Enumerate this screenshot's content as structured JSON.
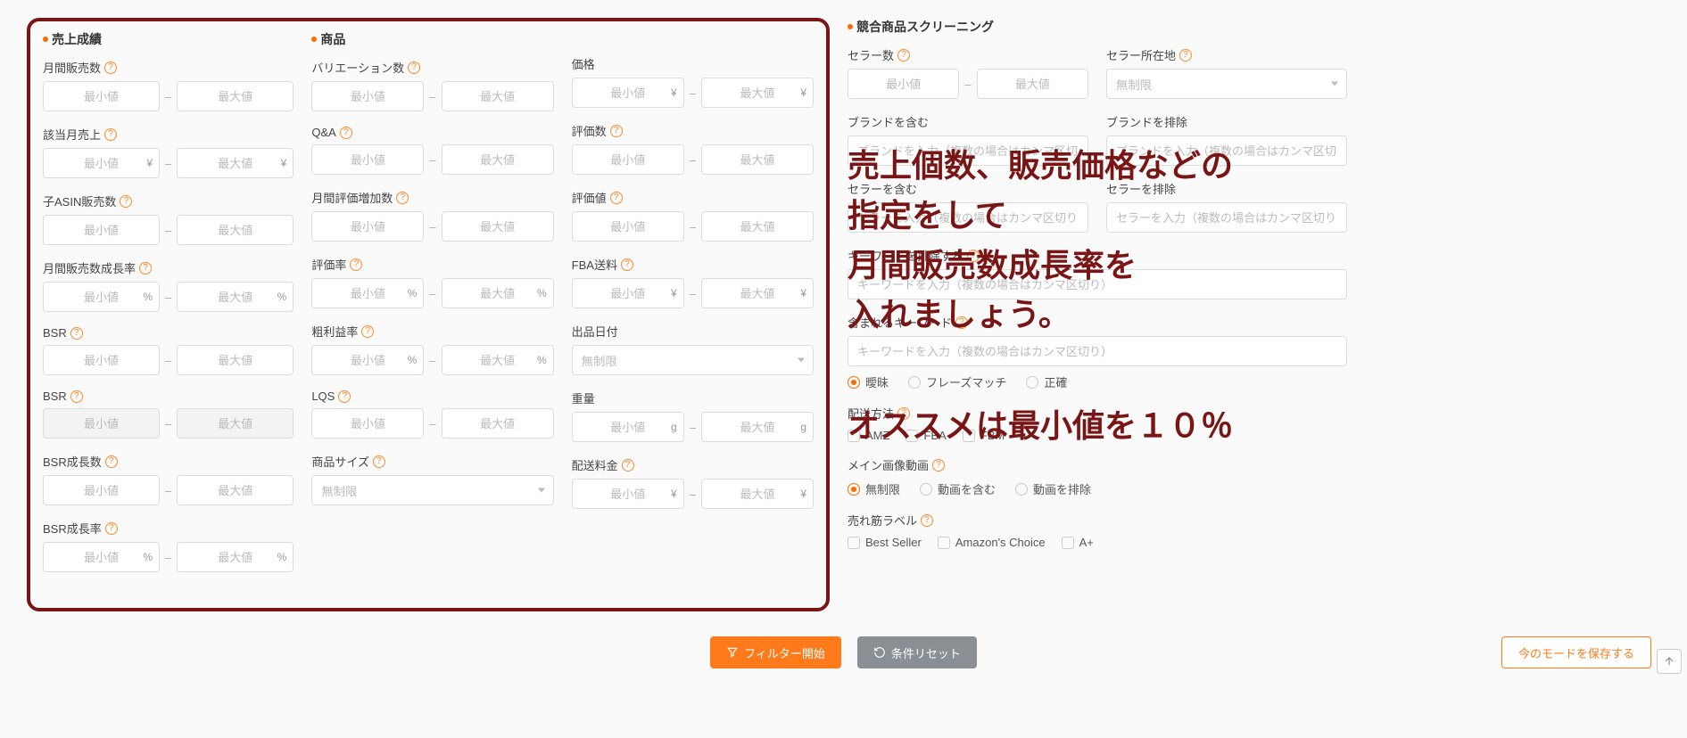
{
  "ph": {
    "min": "最小値",
    "max": "最大値",
    "unlimited": "無制限"
  },
  "units": {
    "yen": "¥",
    "pct": "%",
    "g": "g"
  },
  "sales": {
    "title": "売上成績",
    "fields": {
      "monthlySales": "月間販売数",
      "monthlyRevenue": "該当月売上",
      "childAsinSales": "子ASIN販売数",
      "monthlySalesGrowth": "月間販売数成長率",
      "bsr1": "BSR",
      "bsr2": "BSR",
      "bsrGrowthCount": "BSR成長数",
      "bsrGrowthRate": "BSR成長率"
    }
  },
  "product": {
    "title": "商品",
    "fields": {
      "variations": "バリエーション数",
      "qa": "Q&A",
      "monthlyReviewInc": "月間評価増加数",
      "reviewRate": "評価率",
      "grossMargin": "粗利益率",
      "lqs": "LQS",
      "size": "商品サイズ",
      "price": "価格",
      "reviewCount": "評価数",
      "reviewValue": "評価値",
      "fbaFee": "FBA送料",
      "listDate": "出品日付",
      "weight": "重量",
      "shipFee": "配送料金"
    }
  },
  "comp": {
    "title": "競合商品スクリーニング",
    "fields": {
      "sellerCount": "セラー数",
      "sellerLocation": "セラー所在地",
      "brandInclude": "ブランドを含む",
      "brandExclude": "ブランドを排除",
      "sellerIncludeLabel": "セラーを含む",
      "sellerExcludeLabel": "セラーを排除",
      "brandPh": "ブランドを入力（複数の場合はカンマ区切り）",
      "sellerPh": "セラーを入力（複数の場合はカンマ区切り）",
      "kwExclude": "キーワードを排除する",
      "kwInclude": "含まれるキーワード",
      "kwPh": "キーワードを入力（複数の場合はカンマ区切り）",
      "matchLabel": "",
      "match": {
        "fuzzy": "曖昧",
        "phrase": "フレーズマッチ",
        "exact": "正確"
      },
      "shipMethod": "配送方法",
      "ship": {
        "amz": "AMZ",
        "fba": "FBA",
        "fbm": "FBM"
      },
      "mainVideo": "メイン画像動画",
      "video": {
        "unl": "無制限",
        "inc": "動画を含む",
        "exc": "動画を排除"
      },
      "bestsellerLabel": "売れ筋ラベル",
      "bs": {
        "bestSeller": "Best Seller",
        "ac": "Amazon's Choice",
        "aplus": "A+"
      }
    }
  },
  "buttons": {
    "filter": "フィルター開始",
    "reset": "条件リセット",
    "save": "今のモードを保存する"
  },
  "overlay": {
    "block1": "売上個数、販売価格などの\n指定をして\n月間販売数成長率を\n入れましょう。",
    "block2": "オススメは最小値を１０％"
  }
}
